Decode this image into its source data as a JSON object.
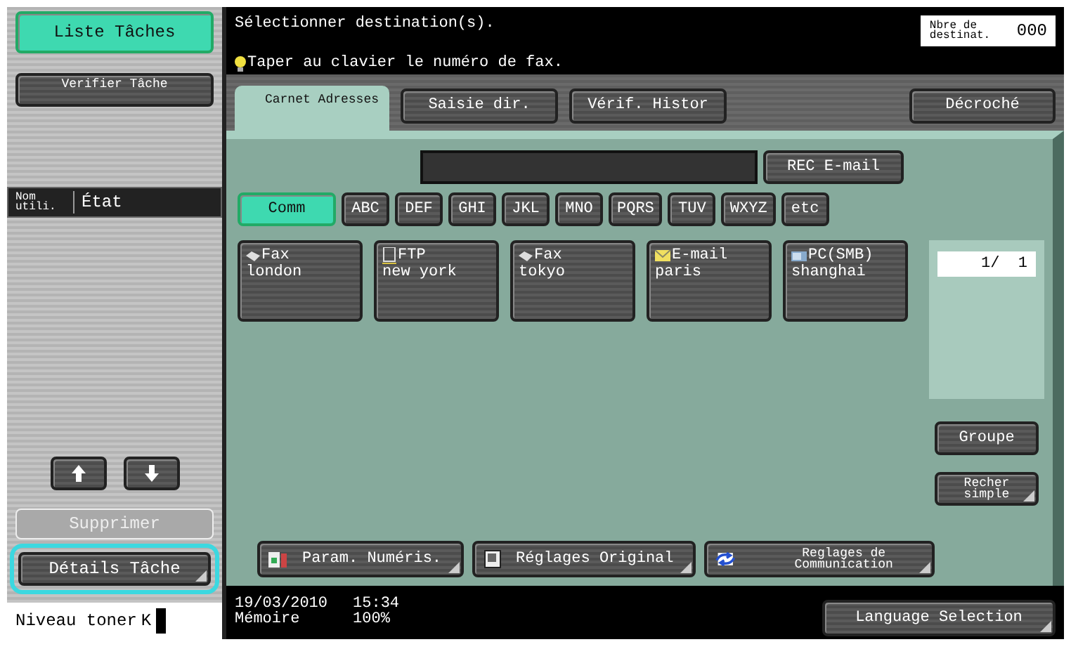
{
  "sidebar": {
    "job_list_button": {
      "label": "Liste Tâches",
      "selected": true
    },
    "check_job_button": {
      "label": "Verifier Tâche"
    },
    "job_columns": [
      "Nom utili.",
      "État"
    ],
    "scroll_buttons": [
      {
        "kind": "up"
      },
      {
        "kind": "down"
      }
    ],
    "delete_button": {
      "label": "Supprimer",
      "disabled": true
    },
    "details_button": {
      "label": "Détails Tâche",
      "highlighted": true
    },
    "toner": {
      "label": "Niveau toner",
      "color_code": "K"
    }
  },
  "header": {
    "title": "Sélectionner destination(s).",
    "counter_label": "Nbre de destinat.",
    "counter_value": "000",
    "hint": "Taper au clavier le numéro de fax."
  },
  "tabs": [
    {
      "label": "Carnet Adresses",
      "kind": "compact",
      "selected": true
    },
    {
      "label": "Saisie dir.",
      "kind": "normal",
      "selected": false
    },
    {
      "label": "Vérif. Histor",
      "kind": "normal",
      "selected": false
    }
  ],
  "off_hook_button": "Décroché",
  "rec_email_button": "REC E-mail",
  "index_tabs": [
    {
      "label": "Comm",
      "selected": true
    },
    {
      "label": "ABC",
      "selected": false
    },
    {
      "label": "DEF",
      "selected": false
    },
    {
      "label": "GHI",
      "selected": false
    },
    {
      "label": "JKL",
      "selected": false
    },
    {
      "label": "MNO",
      "selected": false
    },
    {
      "label": "PQRS",
      "selected": false
    },
    {
      "label": "TUV",
      "selected": false
    },
    {
      "label": "WXYZ",
      "selected": false
    },
    {
      "label": "etc",
      "selected": false
    }
  ],
  "destinations": [
    {
      "kind": "fax",
      "type_label": "Fax",
      "name": "london"
    },
    {
      "kind": "ftp",
      "type_label": "FTP",
      "name": "new york"
    },
    {
      "kind": "fax",
      "type_label": "Fax",
      "name": "tokyo"
    },
    {
      "kind": "email",
      "type_label": "E-mail",
      "name": "paris"
    },
    {
      "kind": "smb",
      "type_label": "PC(SMB)",
      "name": "shanghai"
    }
  ],
  "page_indicator": "1/  1",
  "side_buttons": [
    {
      "label": "Groupe",
      "kind": "normal",
      "corner": false
    },
    {
      "label": "Recher simple",
      "kind": "compact",
      "corner": true
    }
  ],
  "bottom_buttons": [
    {
      "label": "Param. Numéris.",
      "kind": "scan",
      "compact": false
    },
    {
      "label": "Réglages Original",
      "kind": "original",
      "compact": false
    },
    {
      "label": "Reglages de Communication",
      "kind": "communication",
      "compact": true
    }
  ],
  "footer": {
    "date": "19/03/2010",
    "time": "15:34",
    "memory_label": "Mémoire",
    "memory_value": "100%",
    "language_button": "Language Selection"
  }
}
